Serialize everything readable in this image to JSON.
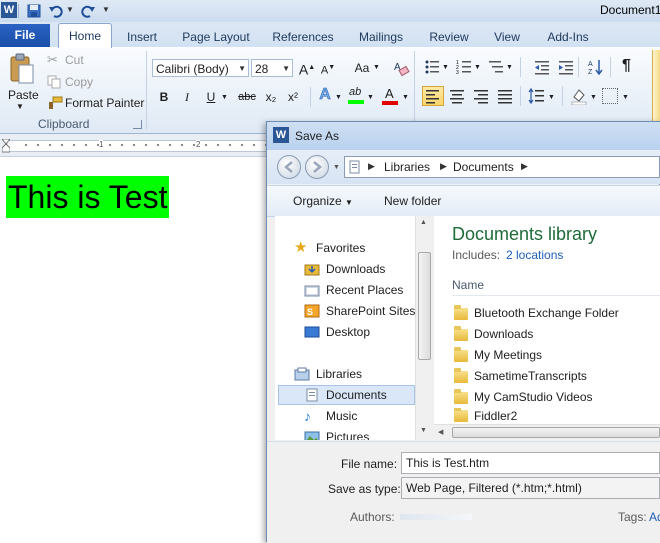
{
  "titlebar": {
    "doc_title": "Document1"
  },
  "tabs": [
    "File",
    "Home",
    "Insert",
    "Page Layout",
    "References",
    "Mailings",
    "Review",
    "View",
    "Add-Ins"
  ],
  "clipboard": {
    "paste": "Paste",
    "cut": "Cut",
    "copy": "Copy",
    "format_painter": "Format Painter",
    "group_label": "Clipboard"
  },
  "font": {
    "name": "Calibri (Body)",
    "size": "28",
    "bold": "B",
    "italic": "I",
    "underline": "U",
    "strike": "abc",
    "subscript": "x₂",
    "superscript": "x²",
    "grow": "A",
    "shrink": "A",
    "case": "Aa",
    "text_effects": "A",
    "highlight": "ab",
    "font_color": "A"
  },
  "ruler": {
    "tick1": "1",
    "tick2": "2"
  },
  "document": {
    "text": "This is Test"
  },
  "save_dialog": {
    "title": "Save As",
    "breadcrumb": [
      "Libraries",
      "Documents"
    ],
    "toolbar": {
      "organize": "Organize",
      "new_folder": "New folder"
    },
    "favorites": {
      "label": "Favorites",
      "items": [
        "Downloads",
        "Recent Places",
        "SharePoint Sites",
        "Desktop"
      ]
    },
    "libraries": {
      "label": "Libraries",
      "items": [
        "Documents",
        "Music",
        "Pictures"
      ]
    },
    "library_title": "Documents library",
    "includes_label": "Includes:",
    "includes_link": "2 locations",
    "column_name": "Name",
    "files": [
      "Bluetooth Exchange Folder",
      "Downloads",
      "My Meetings",
      "SametimeTranscripts",
      "My CamStudio Videos",
      "Fiddler2"
    ],
    "file_name_label": "File name:",
    "file_name_value": "This is Test.htm",
    "save_type_label": "Save as type:",
    "save_type_value": "Web Page, Filtered (*.htm;*.html)",
    "authors_label": "Authors:",
    "tags_label": "Tags:",
    "tags_link": "Ad"
  }
}
